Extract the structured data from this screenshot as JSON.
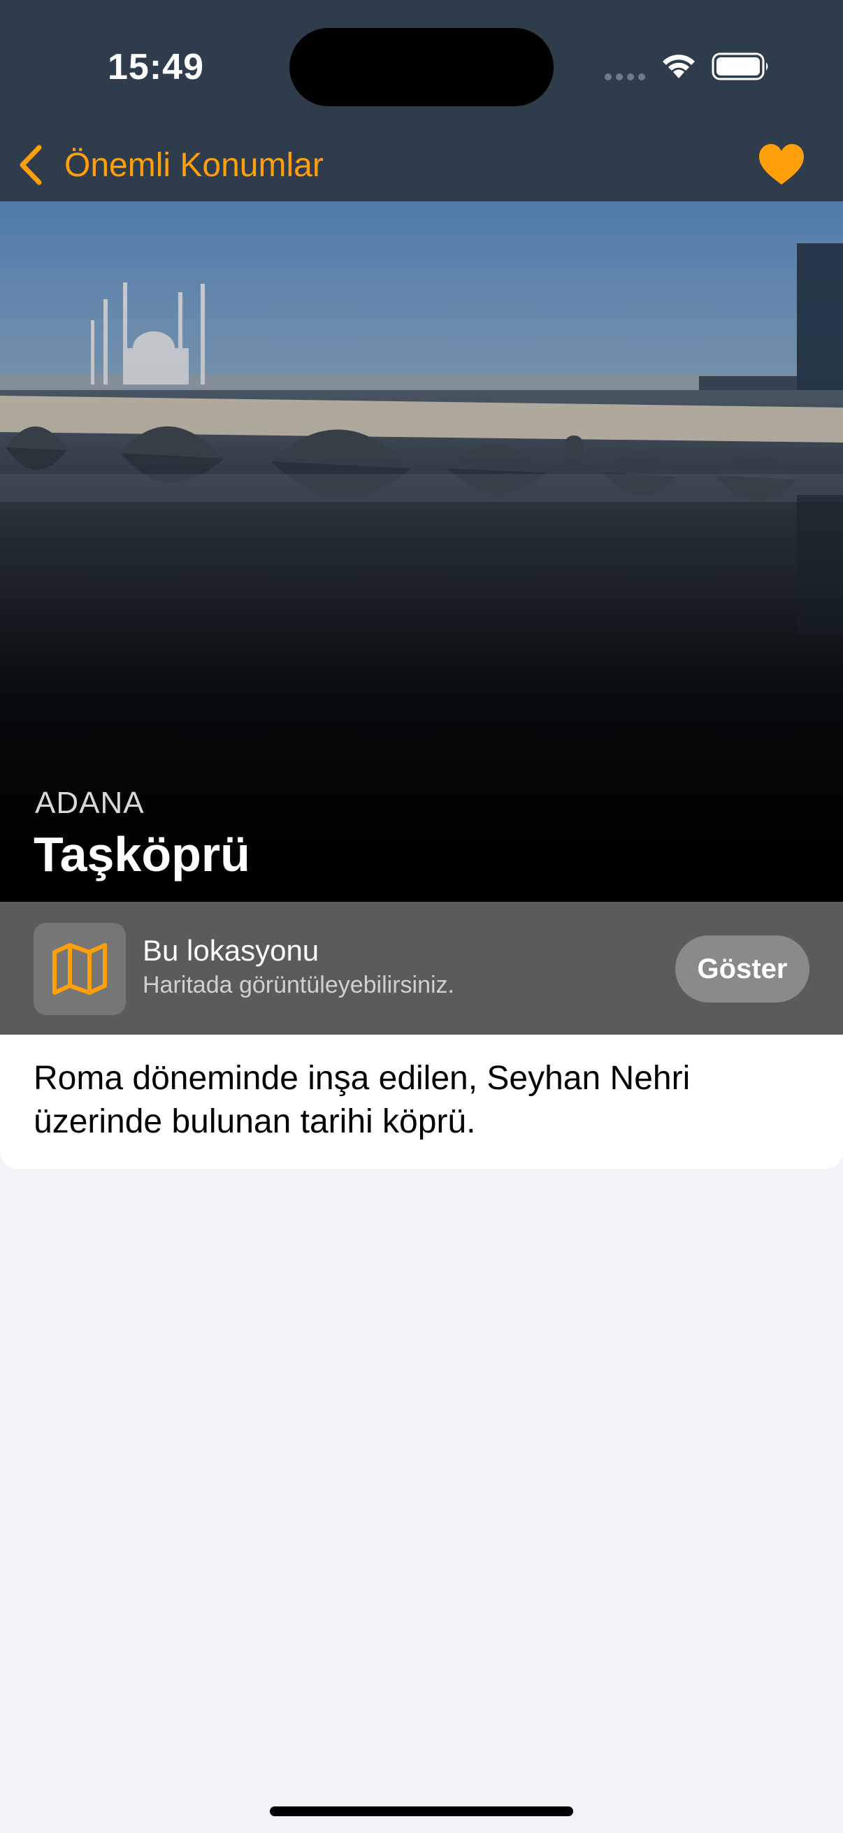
{
  "status_bar": {
    "time": "15:49"
  },
  "nav": {
    "back_label": "Önemli Konumlar",
    "back_icon": "chevron-left-icon",
    "favorite_icon": "heart-icon"
  },
  "place": {
    "region": "ADANA",
    "name": "Taşköprü",
    "description": "Roma döneminde inşa edilen, Seyhan Nehri üzerinde bulunan tarihi köprü."
  },
  "map_row": {
    "icon": "map-icon",
    "title": "Bu lokasyonu",
    "subtitle": "Haritada görüntüleyebilirsiniz.",
    "button_label": "Göster"
  },
  "colors": {
    "accent": "#ff9f0a",
    "header_bg": "#2f3c4c",
    "map_strip_bg": "#5b5b5b",
    "page_bg": "#f2f2f7"
  }
}
